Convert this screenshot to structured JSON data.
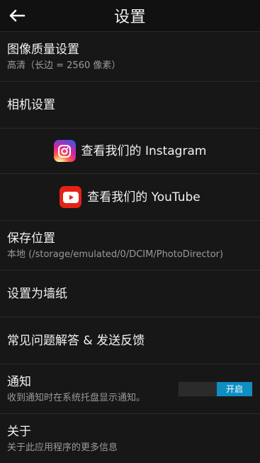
{
  "header": {
    "title": "设置"
  },
  "items": {
    "image_quality": {
      "title": "图像质量设置",
      "subtitle": "高清（长边 = 2560 像素）"
    },
    "camera": {
      "title": "相机设置"
    },
    "instagram": {
      "title": "查看我们的 Instagram",
      "icon": "instagram-icon"
    },
    "youtube": {
      "title": "查看我们的 YouTube",
      "icon": "youtube-icon"
    },
    "save_location": {
      "title": "保存位置",
      "subtitle": "本地 (/storage/emulated/0/DCIM/PhotoDirector)"
    },
    "wallpaper": {
      "title": "设置为墙纸"
    },
    "faq": {
      "title": "常见问题解答 & 发送反馈"
    },
    "notifications": {
      "title": "通知",
      "subtitle": "收到通知时在系统托盘显示通知。",
      "toggle_label": "开启",
      "toggle_state": "on"
    },
    "about": {
      "title": "关于",
      "subtitle": "关于此应用程序的更多信息"
    }
  },
  "colors": {
    "background": "#171717",
    "divider": "#2a2a2a",
    "toggle_on": "#0e8ec3",
    "youtube_red": "#e62117"
  }
}
